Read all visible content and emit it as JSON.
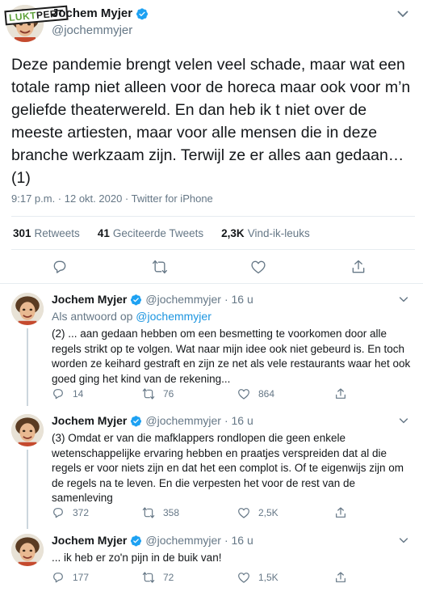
{
  "watermark": {
    "part1": "LUKT",
    "part2": "PERT"
  },
  "main_tweet": {
    "author_name": "Jochem Myjer",
    "handle": "@jochemmyjer",
    "text": "Deze pandemie brengt velen veel schade, maar wat een totale ramp niet alleen voor de horeca maar ook voor m’n geliefde theaterwereld. En dan heb ik t niet over de meeste artiesten, maar voor alle mensen die in deze branche werkzaam zijn. Terwijl ze er alles aan gedaan… (1)",
    "meta": "9:17 p.m. · 12 okt. 2020 · Twitter for iPhone",
    "stats": {
      "retweets_count": "301",
      "retweets_label": "Retweets",
      "quotes_count": "41",
      "quotes_label": "Geciteerde Tweets",
      "likes_count": "2,3K",
      "likes_label": "Vind-ik-leuks"
    }
  },
  "replies": [
    {
      "author_name": "Jochem Myjer",
      "handle": "@jochemmyjer",
      "time": "· 16 u",
      "reply_to_prefix": "Als antwoord op",
      "reply_to_handle": "@jochemmyjer",
      "text": "(2) ... aan gedaan hebben om een besmetting te voorkomen door alle regels strikt op te volgen. Wat naar mijn idee ook niet gebeurd is. En toch worden ze keihard gestraft en zijn ze net als vele restaurants waar het ook goed ging het kind van de rekening...",
      "replies": "14",
      "retweets": "76",
      "likes": "864"
    },
    {
      "author_name": "Jochem Myjer",
      "handle": "@jochemmyjer",
      "time": "· 16 u",
      "text": "(3) Omdat er van die mafklappers rondlopen die geen enkele wetenschappelijke ervaring hebben en praatjes verspreiden dat al die regels er voor niets zijn en dat het een complot is. Of te eigenwijs zijn om de regels na te leven. En die verpesten het voor de rest van de samenleving",
      "replies": "372",
      "retweets": "358",
      "likes": "2,5K"
    },
    {
      "author_name": "Jochem Myjer",
      "handle": "@jochemmyjer",
      "time": "· 16 u",
      "text": "... ik heb er zo'n pijn in de buik van!",
      "replies": "177",
      "retweets": "72",
      "likes": "1,5K"
    }
  ],
  "colors": {
    "text": "#14171a",
    "muted": "#657786",
    "link": "#1b95e0",
    "verified": "#1da1f2",
    "divider": "#e6ecf0"
  }
}
